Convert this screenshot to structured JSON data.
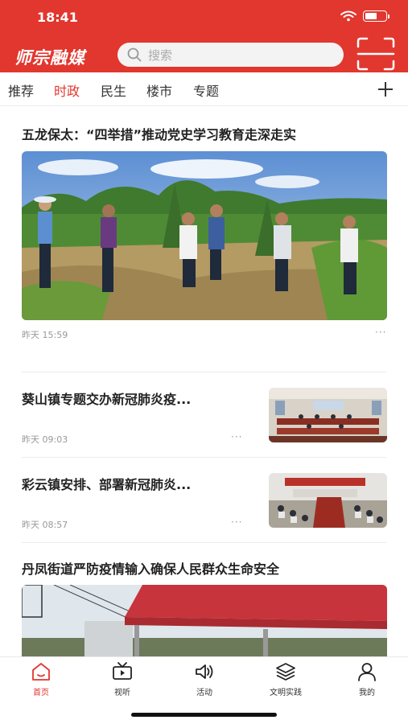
{
  "status_bar": {
    "time": "18:41",
    "battery_level": 0.6
  },
  "app": {
    "logo_text": "师宗融媒",
    "accent_color": "#e2372e"
  },
  "search": {
    "placeholder": "搜索",
    "icon": "search-icon"
  },
  "tabs": [
    {
      "label": "推荐",
      "active": false
    },
    {
      "label": "时政",
      "active": true
    },
    {
      "label": "民生",
      "active": false
    },
    {
      "label": "楼市",
      "active": false
    },
    {
      "label": "专题",
      "active": false
    }
  ],
  "articles": [
    {
      "title": "五龙保太：“四举措”推动党史学习教育走深走实",
      "time": "昨天 15:59",
      "more": "···"
    },
    {
      "title": "葵山镇专题交办新冠肺炎疫...",
      "time": "昨天 09:03",
      "more": "···"
    },
    {
      "title": "彩云镇安排、部署新冠肺炎...",
      "time": "昨天 08:57",
      "more": "···"
    },
    {
      "title": "丹凤街道严防疫情输入确保人民群众生命安全"
    }
  ],
  "bottom_nav": [
    {
      "label": "首页",
      "icon": "home-icon",
      "active": true
    },
    {
      "label": "视听",
      "icon": "tv-icon",
      "active": false
    },
    {
      "label": "活动",
      "icon": "speaker-icon",
      "active": false
    },
    {
      "label": "文明实践",
      "icon": "layers-icon",
      "active": false
    },
    {
      "label": "我的",
      "icon": "user-icon",
      "active": false
    }
  ]
}
